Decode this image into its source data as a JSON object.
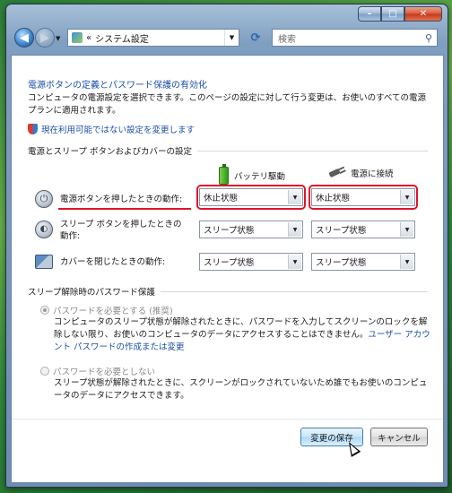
{
  "window": {
    "controls": {
      "minimize": "–",
      "maximize": "□",
      "close": "✕"
    }
  },
  "nav": {
    "back_icon": "arrow-left-icon",
    "forward_icon": "arrow-right-icon",
    "breadcrumb_prefix": "«",
    "address": "システム設定",
    "search_placeholder": "検索"
  },
  "page": {
    "title": "電源ボタンの定義とパスワード保護の有効化",
    "description": "コンピュータの電源設定を選択できます。このページの設定に対して行う変更は、お使いのすべての電源プランに適用されます。",
    "admin_link": "現在利用可能ではない設定を変更します"
  },
  "power_section": {
    "heading": "電源とスリープ ボタンおよびカバーの設定",
    "col_battery": "バッテリ駆動",
    "col_plugged": "電源に接続",
    "rows": [
      {
        "label_line1": "電源ボタンを押したときの動作:",
        "label_line2": "",
        "battery": "休止状態",
        "plugged": "休止状態"
      },
      {
        "label_line1": "スリープ ボタンを押したときの",
        "label_line2": "動作:",
        "battery": "スリープ状態",
        "plugged": "スリープ状態"
      },
      {
        "label_line1": "カバーを閉じたときの動作:",
        "label_line2": "",
        "battery": "スリープ状態",
        "plugged": "スリープ状態"
      }
    ]
  },
  "password_section": {
    "heading": "スリープ解除時のパスワード保護",
    "require": {
      "label": "パスワードを必要とする (推奨)",
      "selected": true,
      "desc_text": "コンピュータのスリープ状態が解除されたときに、パスワードを入力してスクリーンのロックを解除しない限り、お使いのコンピュータのデータにアクセスすることはできません。",
      "desc_link": "ユーザー アカウント パスワードの作成または変更"
    },
    "no_require": {
      "label": "パスワードを必要としない",
      "selected": false,
      "desc_text": "スリープ状態が解除されたときに、スクリーンがロックされていないため誰でもお使いのコンピュータのデータにアクセスできます。"
    }
  },
  "footer": {
    "save_label": "変更の保存",
    "cancel_label": "キャンセル"
  },
  "colors": {
    "highlight": "#e0142a",
    "link": "#1b4fa8"
  }
}
